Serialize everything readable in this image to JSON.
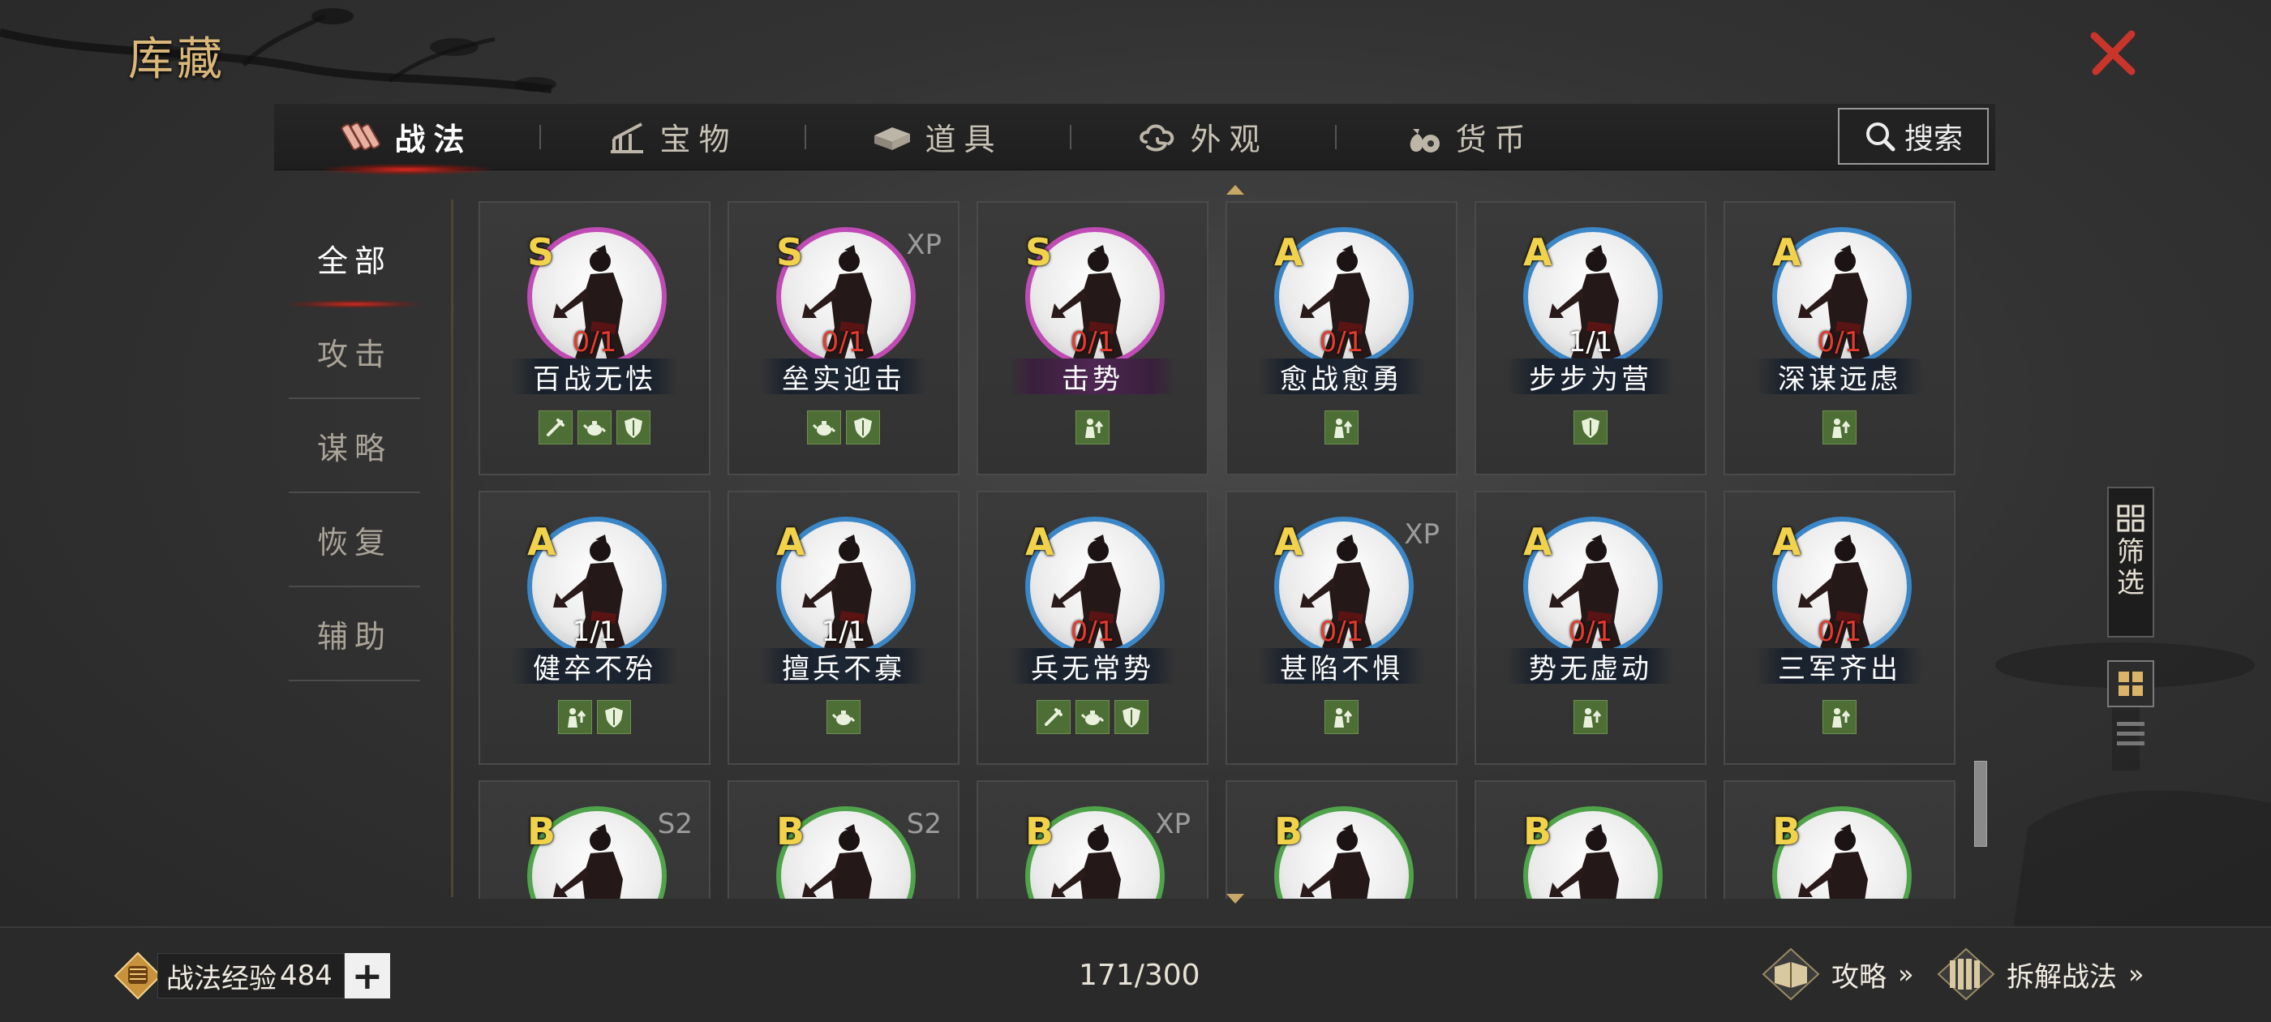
{
  "page": {
    "title": "库藏"
  },
  "tabs": [
    {
      "label": "战法",
      "icon": "scroll-bundle-icon",
      "active": true
    },
    {
      "label": "宝物",
      "icon": "weapon-rack-icon",
      "active": false
    },
    {
      "label": "道具",
      "icon": "chest-icon",
      "active": false
    },
    {
      "label": "外观",
      "icon": "cloud-swirl-icon",
      "active": false
    },
    {
      "label": "货币",
      "icon": "money-bag-icon",
      "active": false
    }
  ],
  "search": {
    "label": "搜索"
  },
  "categories": [
    {
      "label": "全部",
      "active": true
    },
    {
      "label": "攻击",
      "active": false
    },
    {
      "label": "谋略",
      "active": false
    },
    {
      "label": "恢复",
      "active": false
    },
    {
      "label": "辅助",
      "active": false
    }
  ],
  "cards": [
    {
      "grade": "S",
      "tag": "",
      "count": "0/1",
      "name": "百战无怯",
      "plate": "dark",
      "badges": [
        "sword-icon",
        "teapot-icon",
        "shield-icon"
      ]
    },
    {
      "grade": "S",
      "tag": "XP",
      "count": "0/1",
      "name": "垒实迎击",
      "plate": "dark",
      "badges": [
        "teapot-icon",
        "shield-icon"
      ]
    },
    {
      "grade": "S",
      "tag": "",
      "count": "0/1",
      "name": "击势",
      "plate": "purple",
      "badges": [
        "soldier-up-icon"
      ]
    },
    {
      "grade": "A",
      "tag": "",
      "count": "0/1",
      "name": "愈战愈勇",
      "plate": "dark",
      "badges": [
        "soldier-up-icon"
      ]
    },
    {
      "grade": "A",
      "tag": "",
      "count": "1/1",
      "name": "步步为营",
      "plate": "dark",
      "badges": [
        "shield-icon"
      ]
    },
    {
      "grade": "A",
      "tag": "",
      "count": "0/1",
      "name": "深谋远虑",
      "plate": "dark",
      "badges": [
        "soldier-up-icon"
      ]
    },
    {
      "grade": "A",
      "tag": "",
      "count": "1/1",
      "name": "健卒不殆",
      "plate": "dark",
      "badges": [
        "soldier-up-icon",
        "shield-icon"
      ]
    },
    {
      "grade": "A",
      "tag": "",
      "count": "1/1",
      "name": "擅兵不寡",
      "plate": "dark",
      "badges": [
        "teapot-icon"
      ]
    },
    {
      "grade": "A",
      "tag": "",
      "count": "0/1",
      "name": "兵无常势",
      "plate": "dark",
      "badges": [
        "sword-icon",
        "teapot-icon",
        "shield-icon"
      ]
    },
    {
      "grade": "A",
      "tag": "XP",
      "count": "0/1",
      "name": "甚陷不惧",
      "plate": "dark",
      "badges": [
        "soldier-up-icon"
      ]
    },
    {
      "grade": "A",
      "tag": "",
      "count": "0/1",
      "name": "势无虚动",
      "plate": "dark",
      "badges": [
        "soldier-up-icon"
      ]
    },
    {
      "grade": "A",
      "tag": "",
      "count": "0/1",
      "name": "三军齐出",
      "plate": "dark",
      "badges": [
        "soldier-up-icon"
      ]
    },
    {
      "grade": "B",
      "tag": "S2",
      "count": "",
      "name": "",
      "plate": "dark",
      "badges": []
    },
    {
      "grade": "B",
      "tag": "S2",
      "count": "",
      "name": "",
      "plate": "dark",
      "badges": []
    },
    {
      "grade": "B",
      "tag": "XP",
      "count": "",
      "name": "",
      "plate": "dark",
      "badges": []
    },
    {
      "grade": "B",
      "tag": "",
      "count": "",
      "name": "",
      "plate": "dark",
      "badges": []
    },
    {
      "grade": "B",
      "tag": "",
      "count": "",
      "name": "",
      "plate": "dark",
      "badges": []
    },
    {
      "grade": "B",
      "tag": "",
      "count": "",
      "name": "",
      "plate": "dark",
      "badges": []
    }
  ],
  "filter": {
    "label": "筛选"
  },
  "footer": {
    "exp_label": "战法经验",
    "exp_value": "484",
    "plus": "+",
    "capacity": "171/300",
    "guide_label": "攻略",
    "decompose_label": "拆解战法",
    "chevrons": "»"
  },
  "colors": {
    "grade_s_ring": "#c04bb5",
    "grade_a_ring": "#3b86c7",
    "grade_b_ring": "#4fa34a",
    "grade_text": "#f2d24a",
    "count_red": "#e53b2f",
    "badge_green": "#4d6e34",
    "title_gold": "#d9b77a",
    "close_red": "#c9342b"
  }
}
